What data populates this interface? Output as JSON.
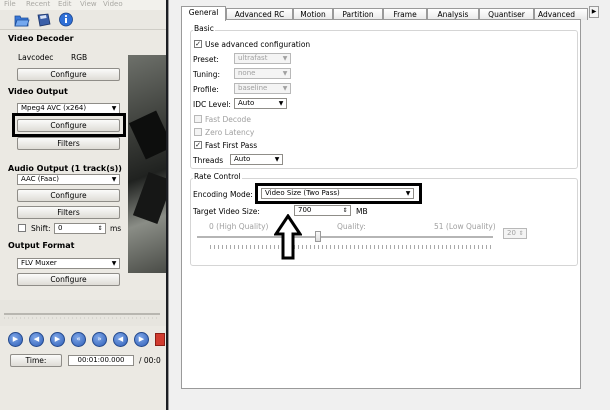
{
  "left": {
    "menu": [
      "File",
      "Recent",
      "Edit",
      "View",
      "Video"
    ],
    "video_decoder": {
      "title": "Video Decoder",
      "codec": "Lavcodec",
      "format": "RGB",
      "configure": "Configure"
    },
    "video_output": {
      "title": "Video Output",
      "codec": "Mpeg4 AVC (x264)",
      "configure": "Configure",
      "filters": "Filters"
    },
    "audio_output": {
      "title": "Audio Output (1 track(s))",
      "codec": "AAC (Faac)",
      "configure": "Configure",
      "filters": "Filters",
      "shift_label": "Shift:",
      "shift_value": "0",
      "shift_unit": "ms"
    },
    "output_format": {
      "title": "Output Format",
      "muxer": "FLV Muxer",
      "configure": "Configure"
    },
    "time": {
      "button": "Time:",
      "value": "00:01:00.000",
      "total": "/ 00:0"
    }
  },
  "dialog": {
    "tabs": [
      "General",
      "Advanced RC",
      "Motion",
      "Partition",
      "Frame",
      "Analysis",
      "Quantiser",
      "Advanced"
    ],
    "basic": {
      "title": "Basic",
      "use_advanced": "Use advanced configuration",
      "preset_label": "Preset:",
      "preset_value": "ultrafast",
      "tuning_label": "Tuning:",
      "tuning_value": "none",
      "profile_label": "Profile:",
      "profile_value": "baseline",
      "idc_label": "IDC Level:",
      "idc_value": "Auto",
      "fast_decode": "Fast Decode",
      "zero_latency": "Zero Latency",
      "fast_first_pass": "Fast First Pass",
      "threads_label": "Threads",
      "threads_value": "Auto"
    },
    "rate_control": {
      "title": "Rate Control",
      "encoding_mode_label": "Encoding Mode:",
      "encoding_mode_value": "Video Size (Two Pass)",
      "target_size_label": "Target Video Size:",
      "target_size_value": "700",
      "target_size_unit": "MB",
      "quality_low_label": "0 (High Quality)",
      "quality_label": "Quality:",
      "quality_high_label": "51 (Low Quality)",
      "quality_value": "20"
    }
  }
}
